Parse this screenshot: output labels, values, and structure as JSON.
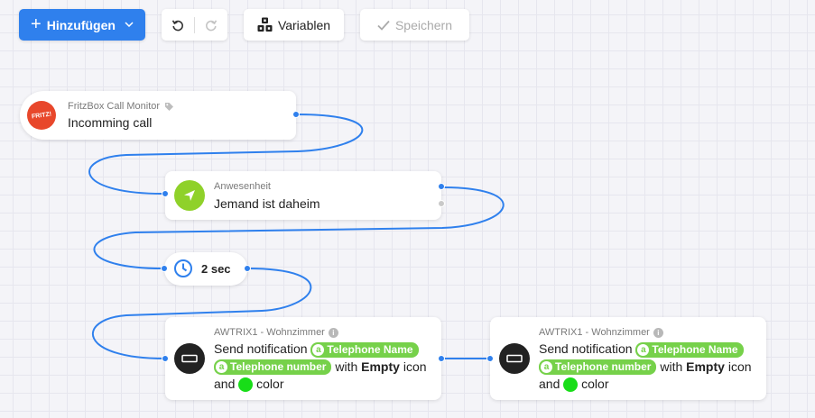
{
  "toolbar": {
    "add_label": "Hinzufügen",
    "variables_label": "Variablen",
    "save_label": "Speichern"
  },
  "nodes": {
    "trigger": {
      "subtitle": "FritzBox Call Monitor",
      "title": "Incomming call",
      "logo_text": "FRITZ!"
    },
    "condition": {
      "subtitle": "Anwesenheit",
      "title": "Jemand ist daheim"
    },
    "delay": {
      "title": "2 sec"
    },
    "action1": {
      "subtitle": "AWTRIX1 - Wohnzimmer",
      "prefix": "Send notification",
      "var1": "Telephone Name",
      "var2": "Telephone number",
      "with": "with",
      "icon_value": "Empty",
      "icon_word": "icon",
      "and": "and",
      "color_word": "color",
      "color_value": "#18dd18"
    },
    "action2": {
      "subtitle": "AWTRIX1 - Wohnzimmer",
      "prefix": "Send notification",
      "var1": "Telephone Name",
      "var2": "Telephone number",
      "with": "with",
      "icon_value": "Empty",
      "icon_word": "icon",
      "and": "and",
      "color_word": "color",
      "color_value": "#18dd18"
    }
  },
  "colors": {
    "accent": "#2f80ed",
    "variable_chip": "#76d14a",
    "trigger_logo": "#e8472b",
    "condition_icon": "#8fd12a",
    "action_icon": "#222222"
  },
  "icons": {
    "add": "plus-icon",
    "undo": "undo-icon",
    "redo": "redo-icon",
    "variables": "blocks-icon",
    "save": "check-icon",
    "condition": "navigation-arrow-icon",
    "delay": "clock-icon",
    "action": "awtrix-display-icon",
    "tag": "tag-icon",
    "info": "info-icon"
  }
}
